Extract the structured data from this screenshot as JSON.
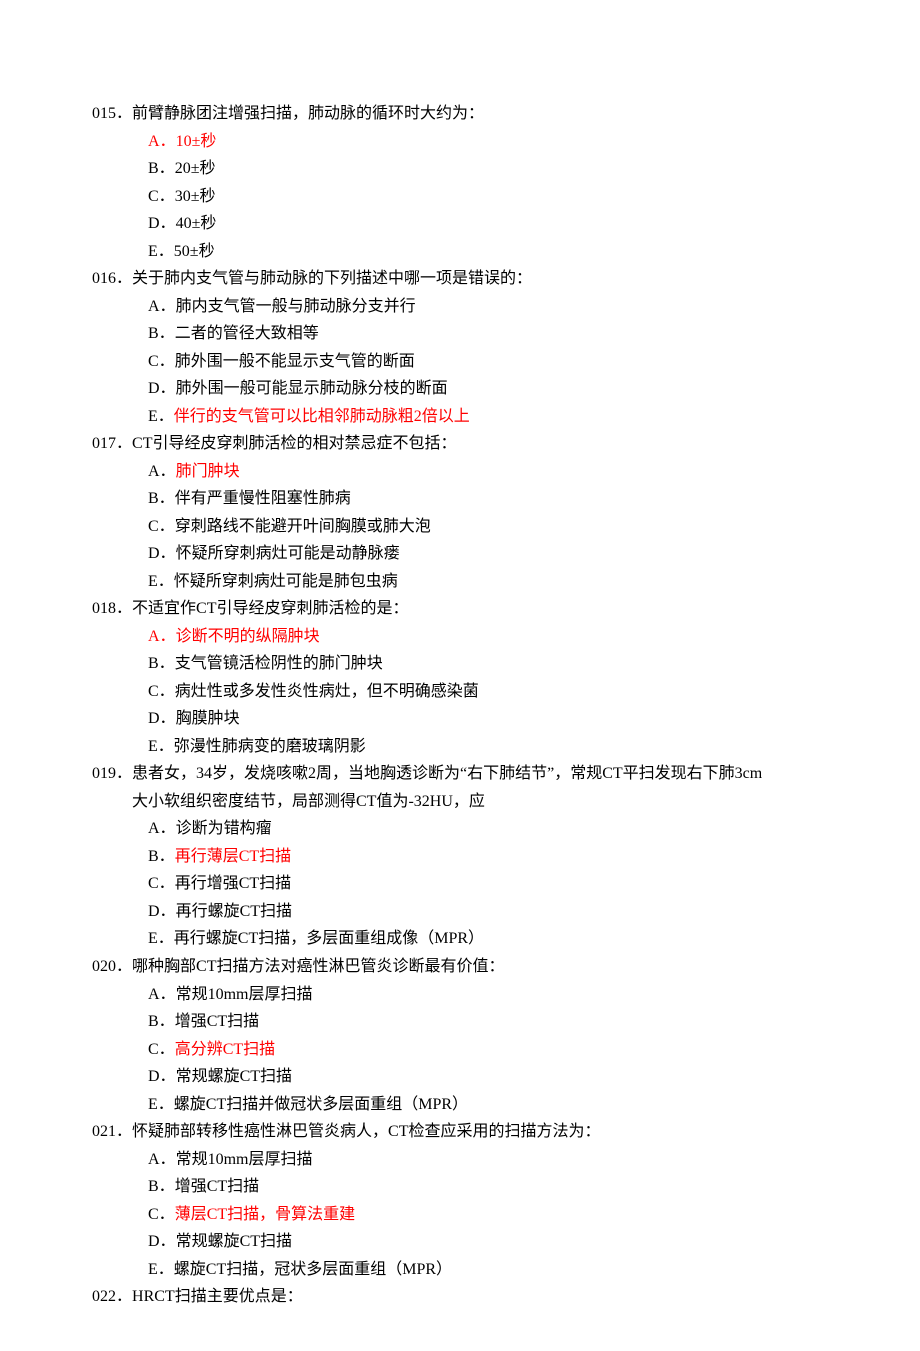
{
  "questions": [
    {
      "number": "015．",
      "stem": "前臂静脉团注增强扫描，肺动脉的循环时大约为：",
      "options": [
        {
          "label": "A．",
          "text": "10±秒",
          "correct": true
        },
        {
          "label": "B．",
          "text": "20±秒",
          "correct": false
        },
        {
          "label": "C．",
          "text": "30±秒",
          "correct": false
        },
        {
          "label": "D．",
          "text": "40±秒",
          "correct": false
        },
        {
          "label": "E．",
          "text": "50±秒",
          "correct": false
        }
      ]
    },
    {
      "number": "016．",
      "stem": "关于肺内支气管与肺动脉的下列描述中哪一项是错误的：",
      "options": [
        {
          "label": "A．",
          "text": "肺内支气管一般与肺动脉分支并行",
          "correct": false
        },
        {
          "label": "B．",
          "text": "二者的管径大致相等",
          "correct": false
        },
        {
          "label": "C．",
          "text": "肺外围一般不能显示支气管的断面",
          "correct": false
        },
        {
          "label": "D．",
          "text": "肺外围一般可能显示肺动脉分枝的断面",
          "correct": false
        },
        {
          "label": "E．",
          "text": "伴行的支气管可以比相邻肺动脉粗2倍以上",
          "correct": true,
          "keep_label_black": true
        }
      ]
    },
    {
      "number": "017．",
      "stem": "CT引导经皮穿刺肺活检的相对禁忌症不包括：",
      "options": [
        {
          "label": "A．",
          "text": "肺门肿块",
          "correct": true,
          "keep_label_black": true
        },
        {
          "label": "B．",
          "text": "伴有严重慢性阻塞性肺病",
          "correct": false
        },
        {
          "label": "C．",
          "text": "穿刺路线不能避开叶间胸膜或肺大泡",
          "correct": false
        },
        {
          "label": "D．",
          "text": "怀疑所穿刺病灶可能是动静脉瘘",
          "correct": false
        },
        {
          "label": "E．",
          "text": "怀疑所穿刺病灶可能是肺包虫病",
          "correct": false
        }
      ]
    },
    {
      "number": "018．",
      "stem": "不适宜作CT引导经皮穿刺肺活检的是：",
      "options": [
        {
          "label": "A．",
          "text": "诊断不明的纵隔肿块",
          "correct": true
        },
        {
          "label": "B．",
          "text": "支气管镜活检阴性的肺门肿块",
          "correct": false
        },
        {
          "label": "C．",
          "text": "病灶性或多发性炎性病灶，但不明确感染菌",
          "correct": false
        },
        {
          "label": "D．",
          "text": "胸膜肿块",
          "correct": false
        },
        {
          "label": "E．",
          "text": "弥漫性肺病变的磨玻璃阴影",
          "correct": false
        }
      ]
    },
    {
      "number": "019．",
      "stem": "患者女，34岁，发烧咳嗽2周，当地胸透诊断为“右下肺结节”，常规CT平扫发现右下肺3cm",
      "stem_cont": "大小软组织密度结节，局部测得CT值为-32HU，应",
      "options": [
        {
          "label": "A．",
          "text": "诊断为错构瘤",
          "correct": false
        },
        {
          "label": "B．",
          "text": "再行薄层CT扫描",
          "correct": true,
          "keep_label_black": true
        },
        {
          "label": "C．",
          "text": "再行增强CT扫描",
          "correct": false
        },
        {
          "label": "D．",
          "text": "再行螺旋CT扫描",
          "correct": false
        },
        {
          "label": "E．",
          "text": "再行螺旋CT扫描，多层面重组成像（MPR）",
          "correct": false
        }
      ]
    },
    {
      "number": "020．",
      "stem": "哪种胸部CT扫描方法对癌性淋巴管炎诊断最有价值：",
      "options": [
        {
          "label": "A．",
          "text": "常规10mm层厚扫描",
          "correct": false
        },
        {
          "label": "B．",
          "text": "增强CT扫描",
          "correct": false
        },
        {
          "label": "C．",
          "text": "高分辨CT扫描",
          "correct": true,
          "keep_label_black": true
        },
        {
          "label": "D．",
          "text": "常规螺旋CT扫描",
          "correct": false
        },
        {
          "label": "E．",
          "text": "螺旋CT扫描并做冠状多层面重组（MPR）",
          "correct": false
        }
      ]
    },
    {
      "number": "021．",
      "stem": "怀疑肺部转移性癌性淋巴管炎病人，CT检查应采用的扫描方法为：",
      "options": [
        {
          "label": "A．",
          "text": "常规10mm层厚扫描",
          "correct": false
        },
        {
          "label": "B．",
          "text": "增强CT扫描",
          "correct": false
        },
        {
          "label": "C．",
          "text": "薄层CT扫描，骨算法重建",
          "correct": true,
          "keep_label_black": true
        },
        {
          "label": "D．",
          "text": "常规螺旋CT扫描",
          "correct": false
        },
        {
          "label": "E．",
          "text": "螺旋CT扫描，冠状多层面重组（MPR）",
          "correct": false
        }
      ]
    },
    {
      "number": "022．",
      "stem": "HRCT扫描主要优点是：",
      "options": []
    }
  ]
}
